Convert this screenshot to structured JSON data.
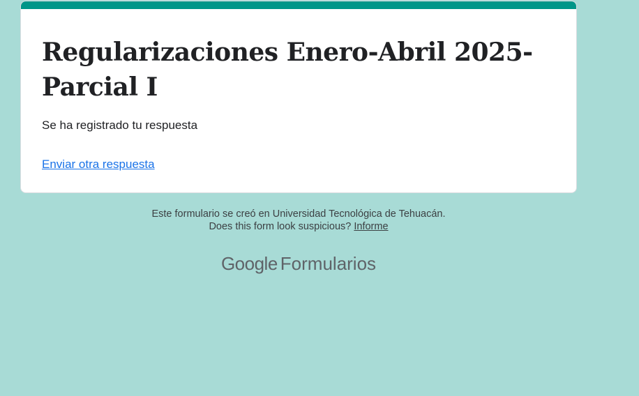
{
  "form": {
    "title": "Regularizaciones Enero-Abril 2025- Parcial I",
    "confirmation_message": "Se ha registrado tu respuesta",
    "another_response_link": "Enviar otra respuesta"
  },
  "footer": {
    "created_in": "Este formulario se creó en Universidad Tecnológica de Tehuacán.",
    "suspicious_prompt": "Does this form look suspicious?",
    "report_link": "Informe"
  },
  "branding": {
    "google": "Google",
    "product": "Formularios"
  },
  "colors": {
    "background": "#a8dbd6",
    "accent_bar": "#009688",
    "link": "#1a73e8"
  }
}
